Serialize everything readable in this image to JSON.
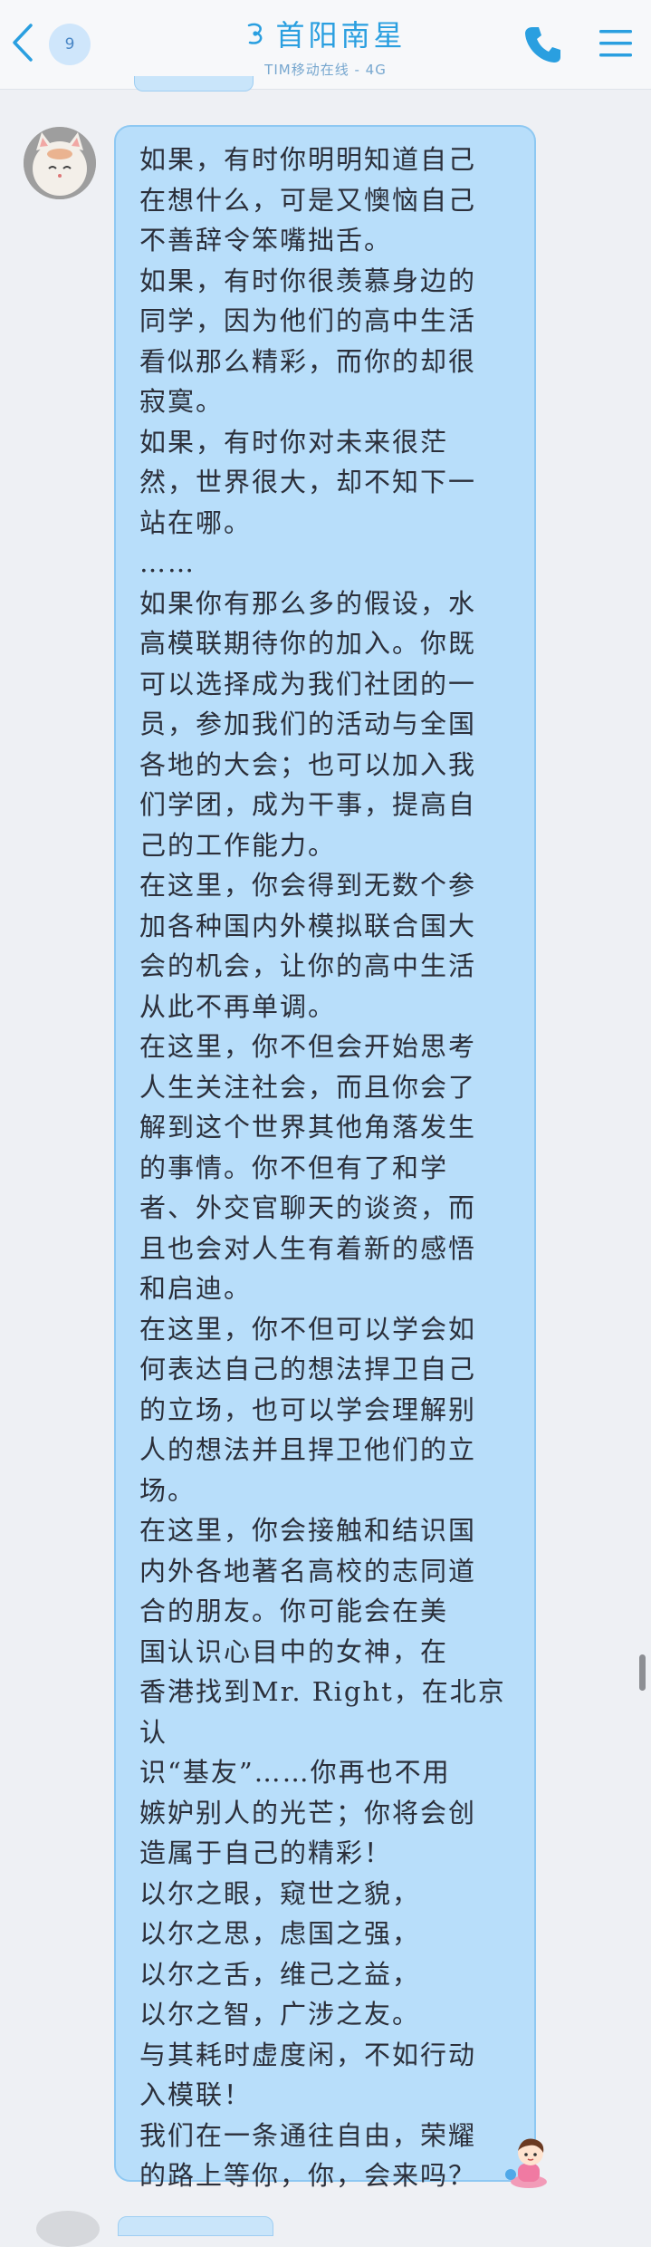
{
  "header": {
    "unread_count": "9",
    "contact_name": "首阳南星",
    "status": "TIM移动在线 - 4G",
    "icons": {
      "back": "chevron-left-icon",
      "contact_status": "status-glyph-icon",
      "call": "phone-icon",
      "menu": "hamburger-menu-icon"
    }
  },
  "message": {
    "lines": [
      "如果，有时你明明知道自己",
      "在想什么，可是又懊恼自己",
      "不善辞令笨嘴拙舌。",
      "如果，有时你很羡慕身边的",
      "同学，因为他们的高中生活",
      "看似那么精彩，而你的却很",
      "寂寞。",
      "如果，有时你对未来很茫",
      "然，世界很大，却不知下一",
      "站在哪。",
      "……",
      "如果你有那么多的假设，水",
      "高模联期待你的加入。你既",
      "可以选择成为我们社团的一",
      "员，参加我们的活动与全国",
      "各地的大会；也可以加入我",
      "们学团，成为干事，提高自",
      "己的工作能力。",
      "在这里，你会得到无数个参",
      "加各种国内外模拟联合国大",
      "会的机会，让你的高中生活",
      "从此不再单调。",
      "在这里，你不但会开始思考",
      "人生关注社会，而且你会了",
      "解到这个世界其他角落发生",
      "的事情。你不但有了和学",
      "者、外交官聊天的谈资，而",
      "且也会对人生有着新的感悟",
      "和启迪。",
      "在这里，你不但可以学会如",
      "何表达自己的想法捍卫自己",
      "的立场，也可以学会理解别",
      "人的想法并且捍卫他们的立",
      "场。",
      "在这里，你会接触和结识国",
      "内外各地著名高校的志同道",
      "合的朋友。你可能会在美",
      "国认识心目中的女神，在",
      "香港找到Mr. Right，在北京认",
      "识“基友”……你再也不用",
      "嫉妒别人的光芒；你将会创",
      "造属于自己的精彩！",
      "以尔之眼，窥世之貌，",
      "以尔之思，虑国之强，",
      "以尔之舌，维己之益，",
      "以尔之智，广涉之友。",
      "与其耗时虚度闲，不如行动",
      "入模联！",
      "我们在一条通往自由，荣耀",
      "的路上等你，你，会来吗？"
    ]
  },
  "decor": {
    "avatar": "cat-avatar-image",
    "sticker": "chibi-character-sticker"
  },
  "colors": {
    "accent": "#2a9fe0",
    "bubble": "#b8defa",
    "bubble_border": "#8ec8f2",
    "background": "#eef0f4",
    "text": "#2b2f3a"
  }
}
